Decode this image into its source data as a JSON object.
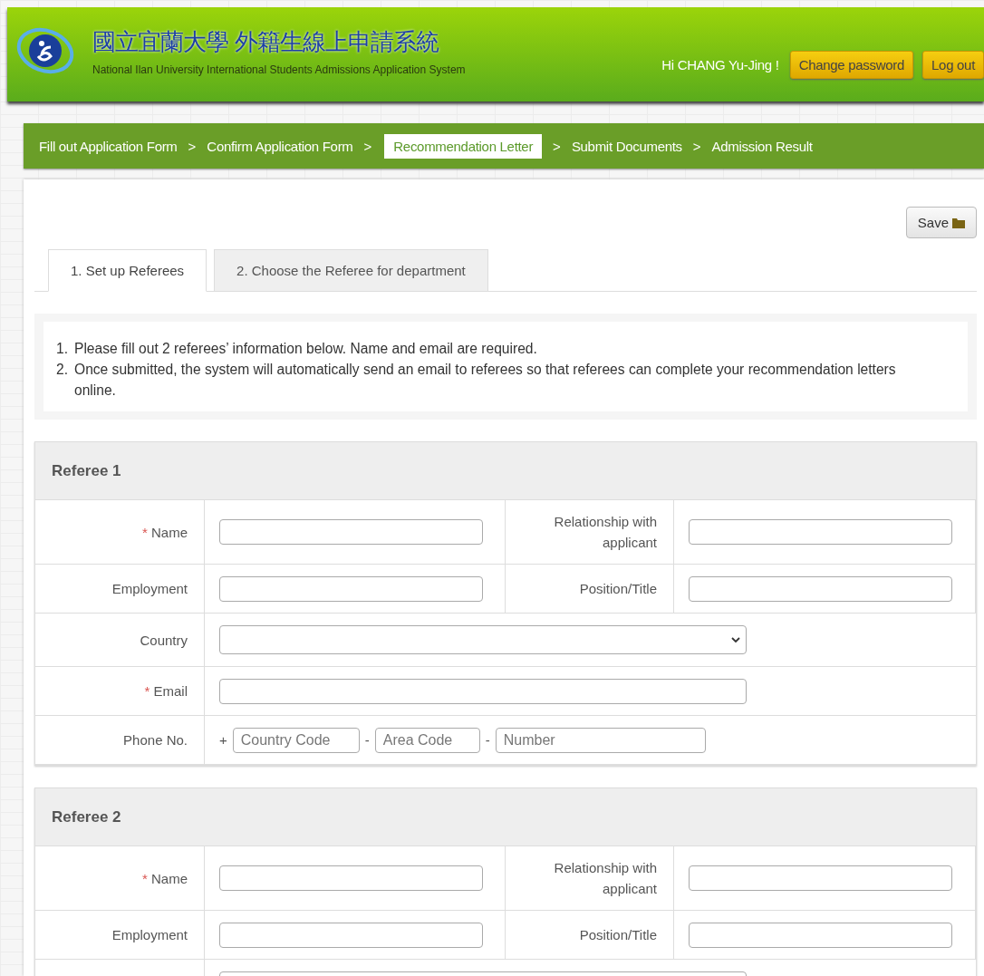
{
  "header": {
    "title": "國立宜蘭大學 外籍生線上申請系統",
    "subtitle": "National Ilan University International Students Admissions Application System",
    "greeting": "Hi CHANG Yu-Jing !",
    "buttons": [
      "Change password",
      "Log out"
    ]
  },
  "steps": [
    {
      "label": "Fill out Application Form",
      "selected": false
    },
    {
      "label": "Confirm Application Form",
      "selected": false
    },
    {
      "label": "Recommendation Letter",
      "selected": true
    },
    {
      "label": "Submit Documents",
      "selected": false
    },
    {
      "label": "Admission Result",
      "selected": false
    }
  ],
  "separator": ">",
  "save_button": "Save",
  "tabs": [
    {
      "label": "1. Set up Referees",
      "selected": true
    },
    {
      "label": "2. Choose the Referee for department",
      "selected": false
    }
  ],
  "notes": [
    {
      "number": "1.",
      "text": "Please fill out 2 referees’ information below. Name and email are required."
    },
    {
      "number": "2.",
      "text": "Once submitted, the system will automatically send an email to referees so that referees can complete your recommendation letters online."
    }
  ],
  "referees": [
    {
      "title": "Referee 1",
      "rows": [
        {
          "kind": "pair",
          "fields": [
            {
              "label": "Name",
              "required": true
            },
            {
              "label": "Relationship with applicant",
              "required": false
            }
          ]
        },
        {
          "kind": "pair",
          "fields": [
            {
              "label": "Employment",
              "required": false
            },
            {
              "label": "Position/Title",
              "required": false
            }
          ]
        },
        {
          "kind": "select",
          "label": "Country",
          "required": false
        },
        {
          "kind": "wide",
          "label": "Email",
          "required": true
        },
        {
          "kind": "phone",
          "label": "Phone No.",
          "required": false,
          "prefix": "+",
          "dash": "-",
          "placeholders": [
            "Country Code",
            "Area Code",
            "Number"
          ]
        }
      ]
    },
    {
      "title": "Referee 2",
      "rows": [
        {
          "kind": "pair",
          "fields": [
            {
              "label": "Name",
              "required": true
            },
            {
              "label": "Relationship with applicant",
              "required": false
            }
          ]
        },
        {
          "kind": "pair",
          "fields": [
            {
              "label": "Employment",
              "required": false
            },
            {
              "label": "Position/Title",
              "required": false
            }
          ]
        },
        {
          "kind": "select_edge"
        }
      ]
    }
  ],
  "required_mark": "*"
}
